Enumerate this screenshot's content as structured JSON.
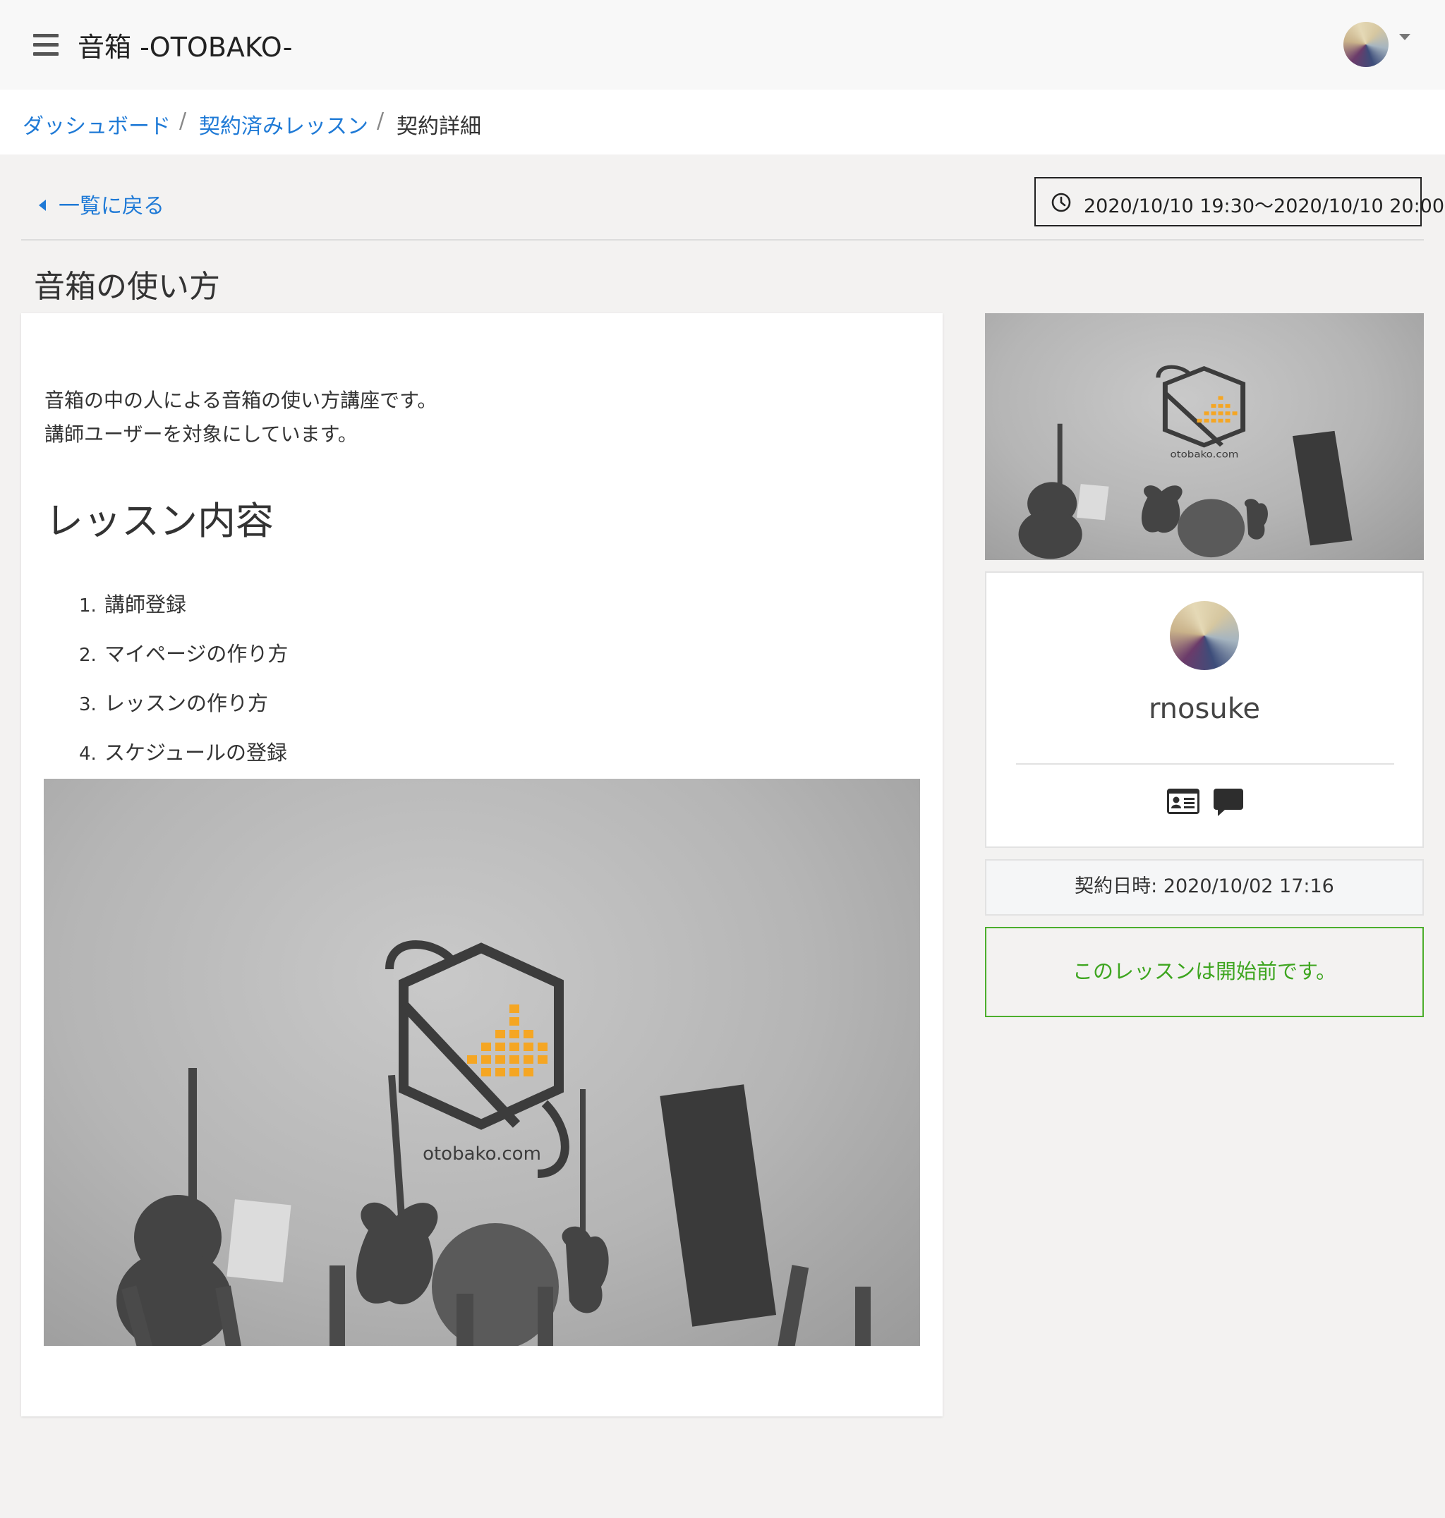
{
  "header": {
    "app_title": "音箱 -OTOBAKO-",
    "menu_icon": "hamburger-menu-icon",
    "avatar_icon": "user-avatar",
    "dropdown_icon": "caret-down-icon"
  },
  "breadcrumb": {
    "items": [
      {
        "label": "ダッシュボード",
        "link": true
      },
      {
        "label": "契約済みレッスン",
        "link": true
      },
      {
        "label": "契約詳細",
        "link": false
      }
    ],
    "separator": "/"
  },
  "back_link": {
    "label": "一覧に戻る",
    "icon": "caret-left-icon"
  },
  "schedule": {
    "icon": "clock-icon",
    "text": "2020/10/10 19:30〜2020/10/10 20:00"
  },
  "lesson": {
    "title": "音箱の使い方",
    "description_lines": [
      "音箱の中の人による音箱の使い方講座です。",
      "講師ユーザーを対象にしています。"
    ],
    "section_heading": "レッスン内容",
    "contents": [
      {
        "num": "1.",
        "text": "講師登録"
      },
      {
        "num": "2.",
        "text": "マイページの作り方"
      },
      {
        "num": "3.",
        "text": "レッスンの作り方"
      },
      {
        "num": "4.",
        "text": "スケジュールの登録"
      }
    ],
    "image_caption": "otobako.com"
  },
  "teacher": {
    "name": "rnosuke",
    "icons": [
      "id-card-icon",
      "chat-bubble-icon"
    ]
  },
  "contract": {
    "label": "契約日時: 2020/10/02 17:16"
  },
  "status": {
    "text": "このレッスンは開始前です。"
  },
  "colors": {
    "link": "#1f7ad6",
    "status_green": "#3da51f",
    "status_border": "#4cae2c",
    "logo_orange": "#f5a623",
    "page_bg": "#f3f2f1"
  }
}
